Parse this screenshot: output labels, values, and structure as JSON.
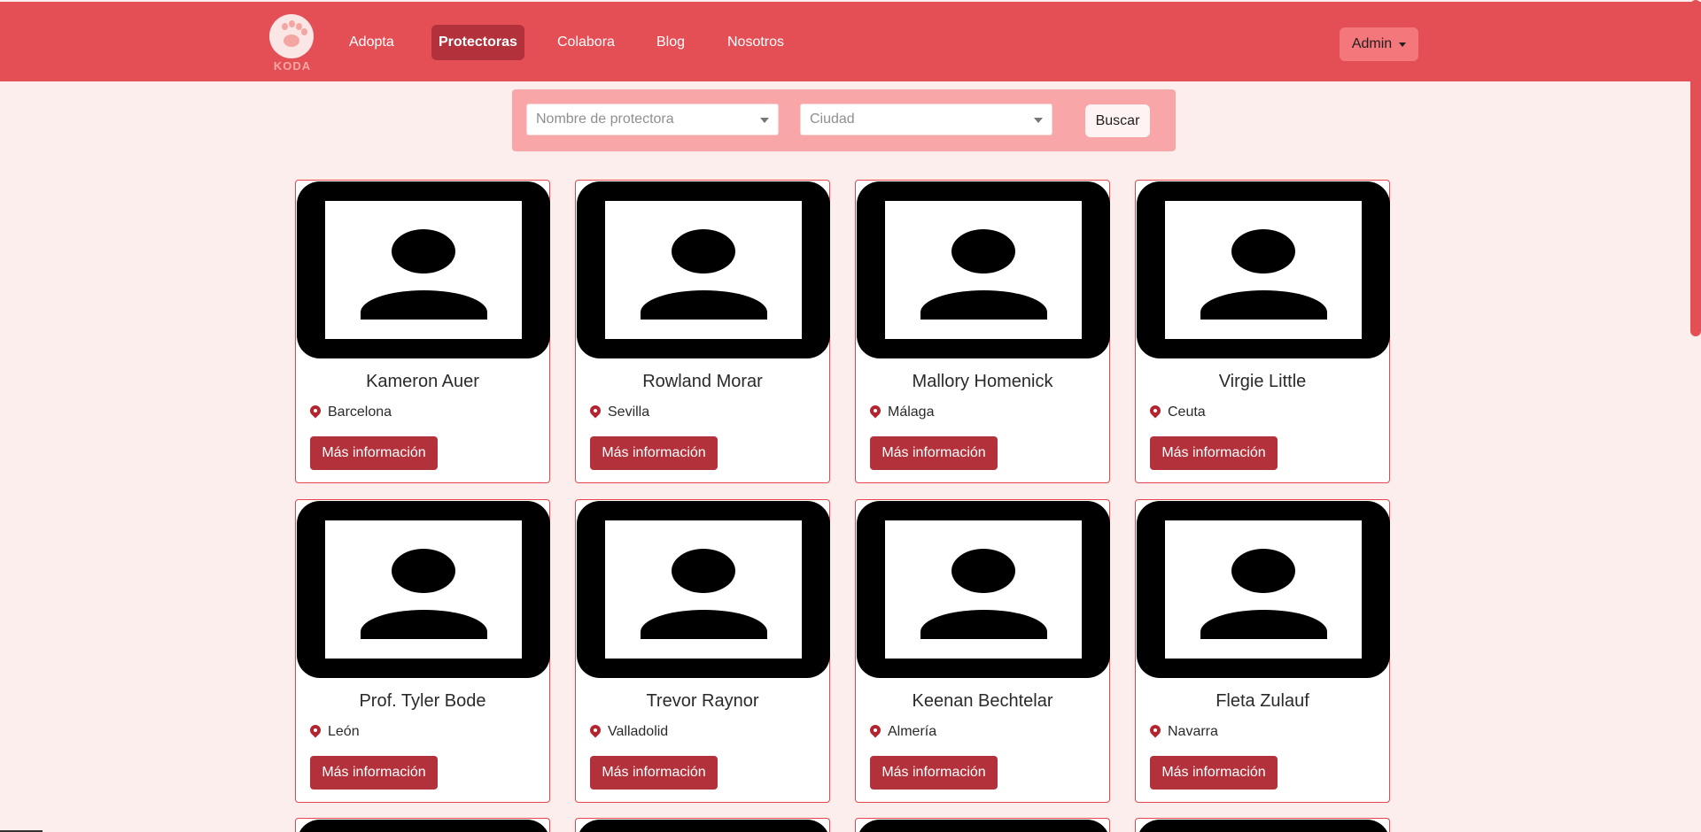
{
  "app": {
    "brand": "KODA",
    "colors": {
      "primary": "#e34f55",
      "accent_dark": "#b2313a",
      "page_background": "#fdeeee",
      "search_panel": "#f8a6a8",
      "admin_button": "#f4777c"
    }
  },
  "nav": {
    "items": [
      {
        "label": "Adopta",
        "active": false
      },
      {
        "label": "Protectoras",
        "active": true
      },
      {
        "label": "Colabora",
        "active": false
      },
      {
        "label": "Blog",
        "active": false
      },
      {
        "label": "Nosotros",
        "active": false
      }
    ],
    "admin_label": "Admin"
  },
  "search": {
    "name_placeholder": "Nombre de protectora",
    "city_placeholder": "Ciudad",
    "button_label": "Buscar"
  },
  "cards": [
    {
      "name": "Kameron Auer",
      "city": "Barcelona",
      "button": "Más información",
      "icon": "location-pin-icon",
      "image": "person-placeholder-icon"
    },
    {
      "name": "Rowland Morar",
      "city": "Sevilla",
      "button": "Más información",
      "icon": "location-pin-icon",
      "image": "person-placeholder-icon"
    },
    {
      "name": "Mallory Homenick",
      "city": "Málaga",
      "button": "Más información",
      "icon": "location-pin-icon",
      "image": "person-placeholder-icon"
    },
    {
      "name": "Virgie Little",
      "city": "Ceuta",
      "button": "Más información",
      "icon": "location-pin-icon",
      "image": "person-placeholder-icon"
    },
    {
      "name": "Prof. Tyler Bode",
      "city": "León",
      "button": "Más información",
      "icon": "location-pin-icon",
      "image": "person-placeholder-icon"
    },
    {
      "name": "Trevor Raynor",
      "city": "Valladolid",
      "button": "Más información",
      "icon": "location-pin-icon",
      "image": "person-placeholder-icon"
    },
    {
      "name": "Keenan Bechtelar",
      "city": "Almería",
      "button": "Más información",
      "icon": "location-pin-icon",
      "image": "person-placeholder-icon"
    },
    {
      "name": "Fleta Zulauf",
      "city": "Navarra",
      "button": "Más información",
      "icon": "location-pin-icon",
      "image": "person-placeholder-icon"
    }
  ]
}
